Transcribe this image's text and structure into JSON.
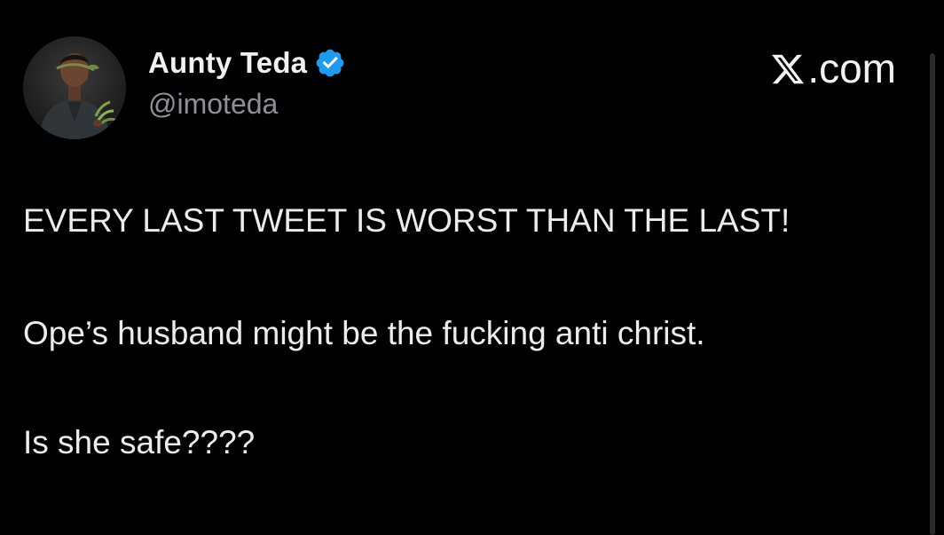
{
  "author": {
    "display_name": "Aunty Teda",
    "handle": "@imoteda",
    "verified": true,
    "avatar_icon": "profile-photo"
  },
  "brand": {
    "text": ".com",
    "logo_icon": "x-logo-icon"
  },
  "tweet": {
    "lines": [
      "EVERY LAST TWEET IS WORST THAN THE LAST!",
      "Ope’s husband might be the fucking anti christ.",
      "Is she safe????"
    ]
  },
  "colors": {
    "background": "#000000",
    "text": "#ececec",
    "secondary_text": "#8b9197",
    "verified_badge": "#1d9bf0"
  }
}
